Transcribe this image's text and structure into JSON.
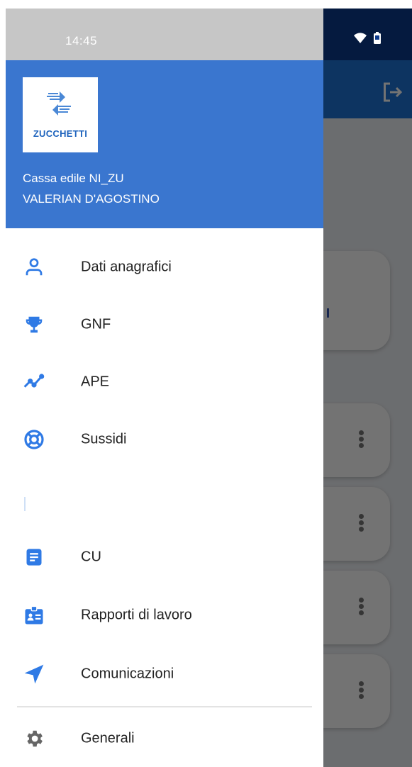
{
  "status_bar": {
    "time": "14:45"
  },
  "header": {
    "logo_text": "ZUCCHETTI",
    "company": "Cassa edile NI_ZU",
    "user": "VALERIAN D'AGOSTINO"
  },
  "menu": [
    {
      "label": "Dati anagrafici",
      "icon": "person-icon"
    },
    {
      "label": "GNF",
      "icon": "trophy-icon"
    },
    {
      "label": "APE",
      "icon": "trend-line-icon"
    },
    {
      "label": "Sussidi",
      "icon": "lifebuoy-icon"
    },
    {
      "label": "CU",
      "icon": "document-icon"
    },
    {
      "label": "Rapporti di lavoro",
      "icon": "id-badge-icon"
    },
    {
      "label": "Comunicazioni",
      "icon": "send-icon"
    },
    {
      "label": "Generali",
      "icon": "gear-icon"
    }
  ],
  "background_app": {
    "card_text": "I"
  },
  "colors": {
    "accent": "#2f7ae5",
    "header": "#3a76cf",
    "status_bar": "#c6c6c6",
    "app_bar": "#1e73d8",
    "app_status": "#0d3a8c"
  }
}
